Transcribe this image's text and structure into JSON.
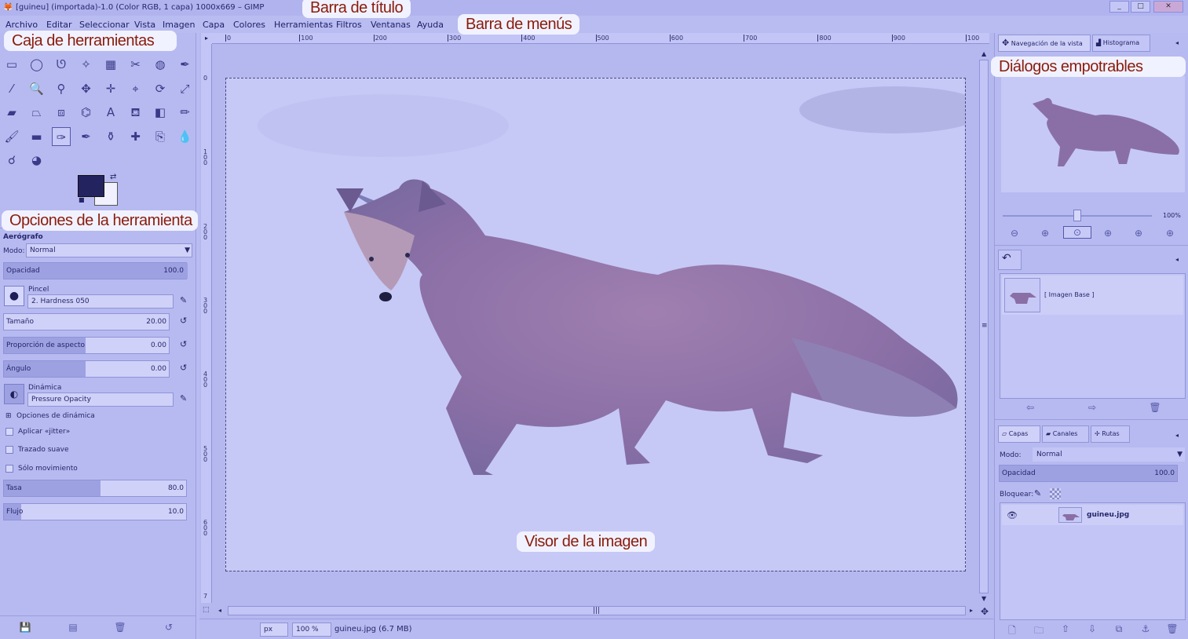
{
  "window": {
    "title": "[guineu] (importada)-1.0 (Color RGB, 1 capa) 1000x669 – GIMP",
    "controls": [
      "_",
      "□",
      "✕"
    ]
  },
  "menu": [
    "Archivo",
    "Editar",
    "Seleccionar",
    "Vista",
    "Imagen",
    "Capa",
    "Colores",
    "Herramientas",
    "Filtros",
    "Ventanas",
    "Ayuda"
  ],
  "callouts": {
    "title_bar": "Barra de título",
    "menu_bar": "Barra de menús",
    "toolbox": "Caja de herramientas",
    "tool_options": "Opciones de la herramienta",
    "dockable_dialogs": "Diálogos empotrables",
    "image_viewer": "Visor de la imagen"
  },
  "tools": [
    "rect-select-icon",
    "ellipse-select-icon",
    "free-select-icon",
    "fuzzy-select-icon",
    "color-select-icon",
    "scissors-icon",
    "foreground-select-icon",
    "paths-icon",
    "color-picker-icon",
    "zoom-icon",
    "measure-icon",
    "move-icon",
    "align-icon",
    "crop-icon",
    "rotate-icon",
    "scale-icon",
    "shear-icon",
    "perspective-icon",
    "transform-icon",
    "cage-icon",
    "text-icon",
    "bucket-fill-icon",
    "gradient-icon",
    "pencil-icon",
    "paintbrush-icon",
    "eraser-icon",
    "airbrush-icon",
    "ink-icon",
    "clone-icon",
    "heal-icon",
    "perspective-clone-icon",
    "blur-icon",
    "smudge-icon",
    "dodge-burn-icon"
  ],
  "tool_options": {
    "tool_name": "Aerógrafo",
    "mode_label": "Modo:",
    "mode_value": "Normal",
    "opacity_label": "Opacidad",
    "opacity_value": "100.0",
    "opacity_fraction": 1.0,
    "brush_label": "Pincel",
    "brush_value": "2. Hardness 050",
    "size_label": "Tamaño",
    "size_value": "20.00",
    "aspect_label": "Proporción de aspecto",
    "aspect_value": "0.00",
    "angle_label": "Ángulo",
    "angle_value": "0.00",
    "dynamics_label": "Dinámica",
    "dynamics_value": "Pressure Opacity",
    "dynamics_options": "Opciones de dinámica",
    "jitter": "Aplicar «jitter»",
    "smooth": "Trazado suave",
    "motion_only": "Sólo movimiento",
    "rate_label": "Tasa",
    "rate_value": "80.0",
    "rate_fraction": 0.8,
    "flow_label": "Flujo",
    "flow_value": "10.0",
    "flow_fraction": 0.1
  },
  "ruler_h": [
    "0",
    "100",
    "200",
    "300",
    "400",
    "500",
    "600",
    "700",
    "800",
    "900",
    "100"
  ],
  "ruler_v": [
    "0",
    "1\n0\n0",
    "2\n0\n0",
    "3\n0\n0",
    "4\n0\n0",
    "5\n0\n0",
    "6\n0\n0",
    "7"
  ],
  "status": {
    "unit": "px",
    "zoom": "100 %",
    "file_info": "guineu.jpg (6.7 MB)"
  },
  "dock": {
    "nav_tab": "Navegación de la vista",
    "histogram_tab": "Histograma",
    "zoom_value": "100%",
    "undo_item": "[ Imagen Base ]",
    "layers_tab": "Capas",
    "channels_tab": "Canales",
    "paths_tab": "Rutas",
    "mode_label": "Modo:",
    "mode_value": "Normal",
    "opacity_label": "Opacidad",
    "opacity_value": "100.0",
    "lock_label": "Bloquear:",
    "layer_name": "guineu.jpg"
  }
}
